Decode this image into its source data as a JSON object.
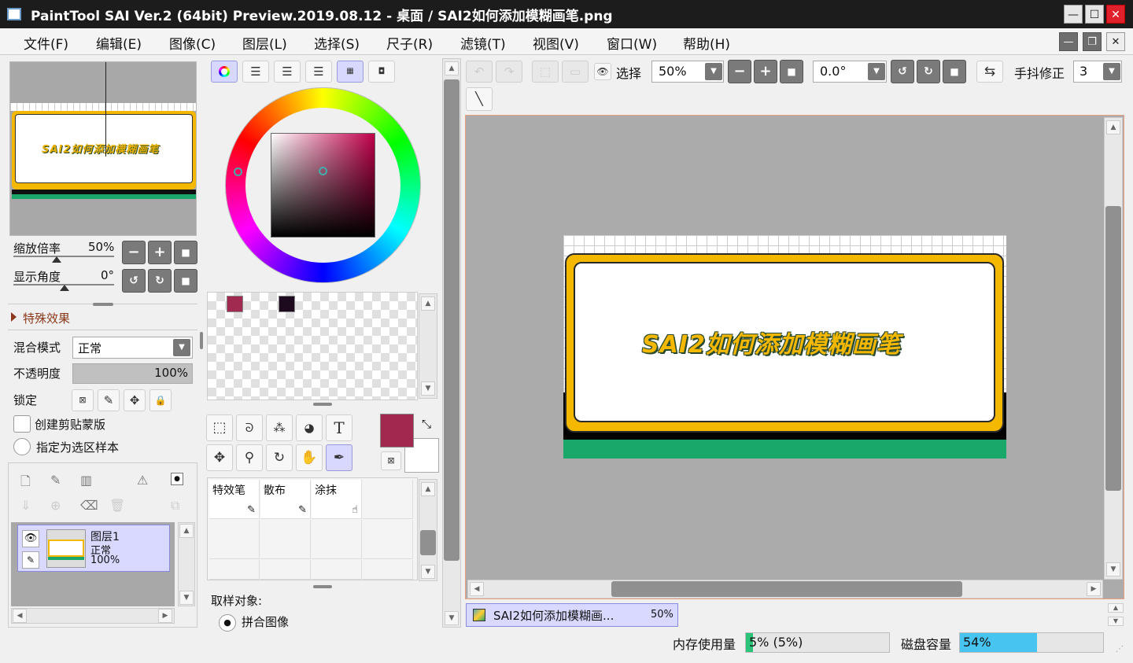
{
  "window": {
    "title": "PaintTool SAI Ver.2 (64bit) Preview.2019.08.12 - 桌面 / SAI2如何添加模糊画笔.png"
  },
  "menu": [
    "文件(F)",
    "编辑(E)",
    "图像(C)",
    "图层(L)",
    "选择(S)",
    "尺子(R)",
    "滤镜(T)",
    "视图(V)",
    "窗口(W)",
    "帮助(H)"
  ],
  "navigator": {
    "zoom_label": "缩放倍率",
    "zoom_value": "50%",
    "angle_label": "显示角度",
    "angle_value": "0°"
  },
  "layer_props": {
    "effects_label": "特殊效果",
    "blend_label": "混合模式",
    "blend_value": "正常",
    "opacity_label": "不透明度",
    "opacity_value": "100%",
    "opacity_fraction": 1.0,
    "lock_label": "锁定",
    "clip_label": "创建剪贴蒙版",
    "selection_source_label": "指定为选区样本"
  },
  "layers": [
    {
      "name": "图层1",
      "mode": "正常",
      "opacity": "100%"
    }
  ],
  "colors": {
    "primary": "#a3284f",
    "secondary": "#ffffff",
    "swatch1": "#a02a50",
    "swatch2": "#1e0a1e",
    "accent": "#f5b800"
  },
  "tools": {
    "text_glyph": "T"
  },
  "brushes": [
    {
      "name": "特效笔"
    },
    {
      "name": "散布"
    },
    {
      "name": "涂抹"
    }
  ],
  "sample": {
    "label": "取样对象:",
    "option": "拼合图像"
  },
  "toolbar": {
    "select_label": "选择",
    "zoom_value": "50%",
    "angle_value": "0.0°",
    "stabilizer_label": "手抖修正",
    "stabilizer_value": "3"
  },
  "canvas_art": {
    "text": "SAI2如何添加模糊画笔"
  },
  "doc_tab": {
    "name": "SAI2如何添加模糊画...",
    "zoom": "50%"
  },
  "status": {
    "memory_label": "内存使用量",
    "memory_value": "5% (5%)",
    "memory_fraction": 0.05,
    "disk_label": "磁盘容量",
    "disk_value": "54%",
    "disk_fraction": 0.54
  }
}
